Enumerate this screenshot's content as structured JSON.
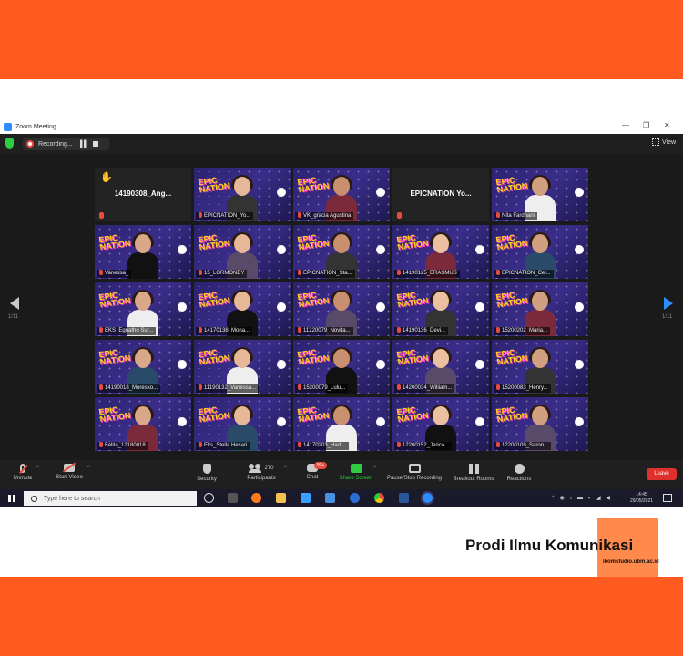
{
  "window": {
    "title": "Zoom Meeting"
  },
  "topbar": {
    "recording_label": "Recording...",
    "view_label": "View"
  },
  "nav": {
    "page_left": "1/11",
    "page_right": "1/11"
  },
  "participants": [
    {
      "name": "14190308_Ang...",
      "style": "name-only",
      "hand": true
    },
    {
      "name": "EPICNATION_Yo...",
      "style": "video",
      "active": true
    },
    {
      "name": "VK_gracia Agustina",
      "style": "video"
    },
    {
      "name": "EPICNATION Yo...",
      "style": "name-only"
    },
    {
      "name": "Nita Fardhani",
      "style": "video"
    },
    {
      "name": "Vanessa_",
      "style": "video"
    },
    {
      "name": "15_LORMONEY",
      "style": "video"
    },
    {
      "name": "EPICNATION_Sta...",
      "style": "video"
    },
    {
      "name": "14190125_ERASMUS",
      "style": "video"
    },
    {
      "name": "EPICNATION_Cel...",
      "style": "video"
    },
    {
      "name": "EKS_Egnatho Sur...",
      "style": "video"
    },
    {
      "name": "14170138_Mona...",
      "style": "video"
    },
    {
      "name": "11220079_Novita...",
      "style": "video"
    },
    {
      "name": "14190136_Devi...",
      "style": "video"
    },
    {
      "name": "15200202_Maria...",
      "style": "video"
    },
    {
      "name": "14190018_Moresko...",
      "style": "video"
    },
    {
      "name": "11190132_Vanessa...",
      "style": "video"
    },
    {
      "name": "15200079_Lulu...",
      "style": "video"
    },
    {
      "name": "14200034_William...",
      "style": "video"
    },
    {
      "name": "15200083_Henry...",
      "style": "video"
    },
    {
      "name": "Felita_12180018",
      "style": "video"
    },
    {
      "name": "Eks_Stella Hesari",
      "style": "video"
    },
    {
      "name": "14170203_Hadi...",
      "style": "video"
    },
    {
      "name": "12200152_Jerica...",
      "style": "video"
    },
    {
      "name": "12200109_Saron...",
      "style": "video"
    }
  ],
  "toolbar": {
    "unmute": "Unmute",
    "start_video": "Start Video",
    "security": "Security",
    "participants": "Participants",
    "participants_count": "270",
    "chat": "Chat",
    "chat_badge": "99+",
    "share_screen": "Share Screen",
    "pause_recording": "Pause/Stop Recording",
    "breakout_rooms": "Breakout Rooms",
    "reactions": "Reactions",
    "leave": "Leave"
  },
  "taskbar": {
    "search_placeholder": "Type here to search",
    "time": "14:45",
    "date": "29/05/2021"
  },
  "branding": {
    "title": "Prodi Ilmu Komunikasi",
    "url": "ikomstudio.ubm.ac.id",
    "colors": {
      "orange": "#ff5a1f",
      "accent": "#ff8a4c"
    }
  }
}
